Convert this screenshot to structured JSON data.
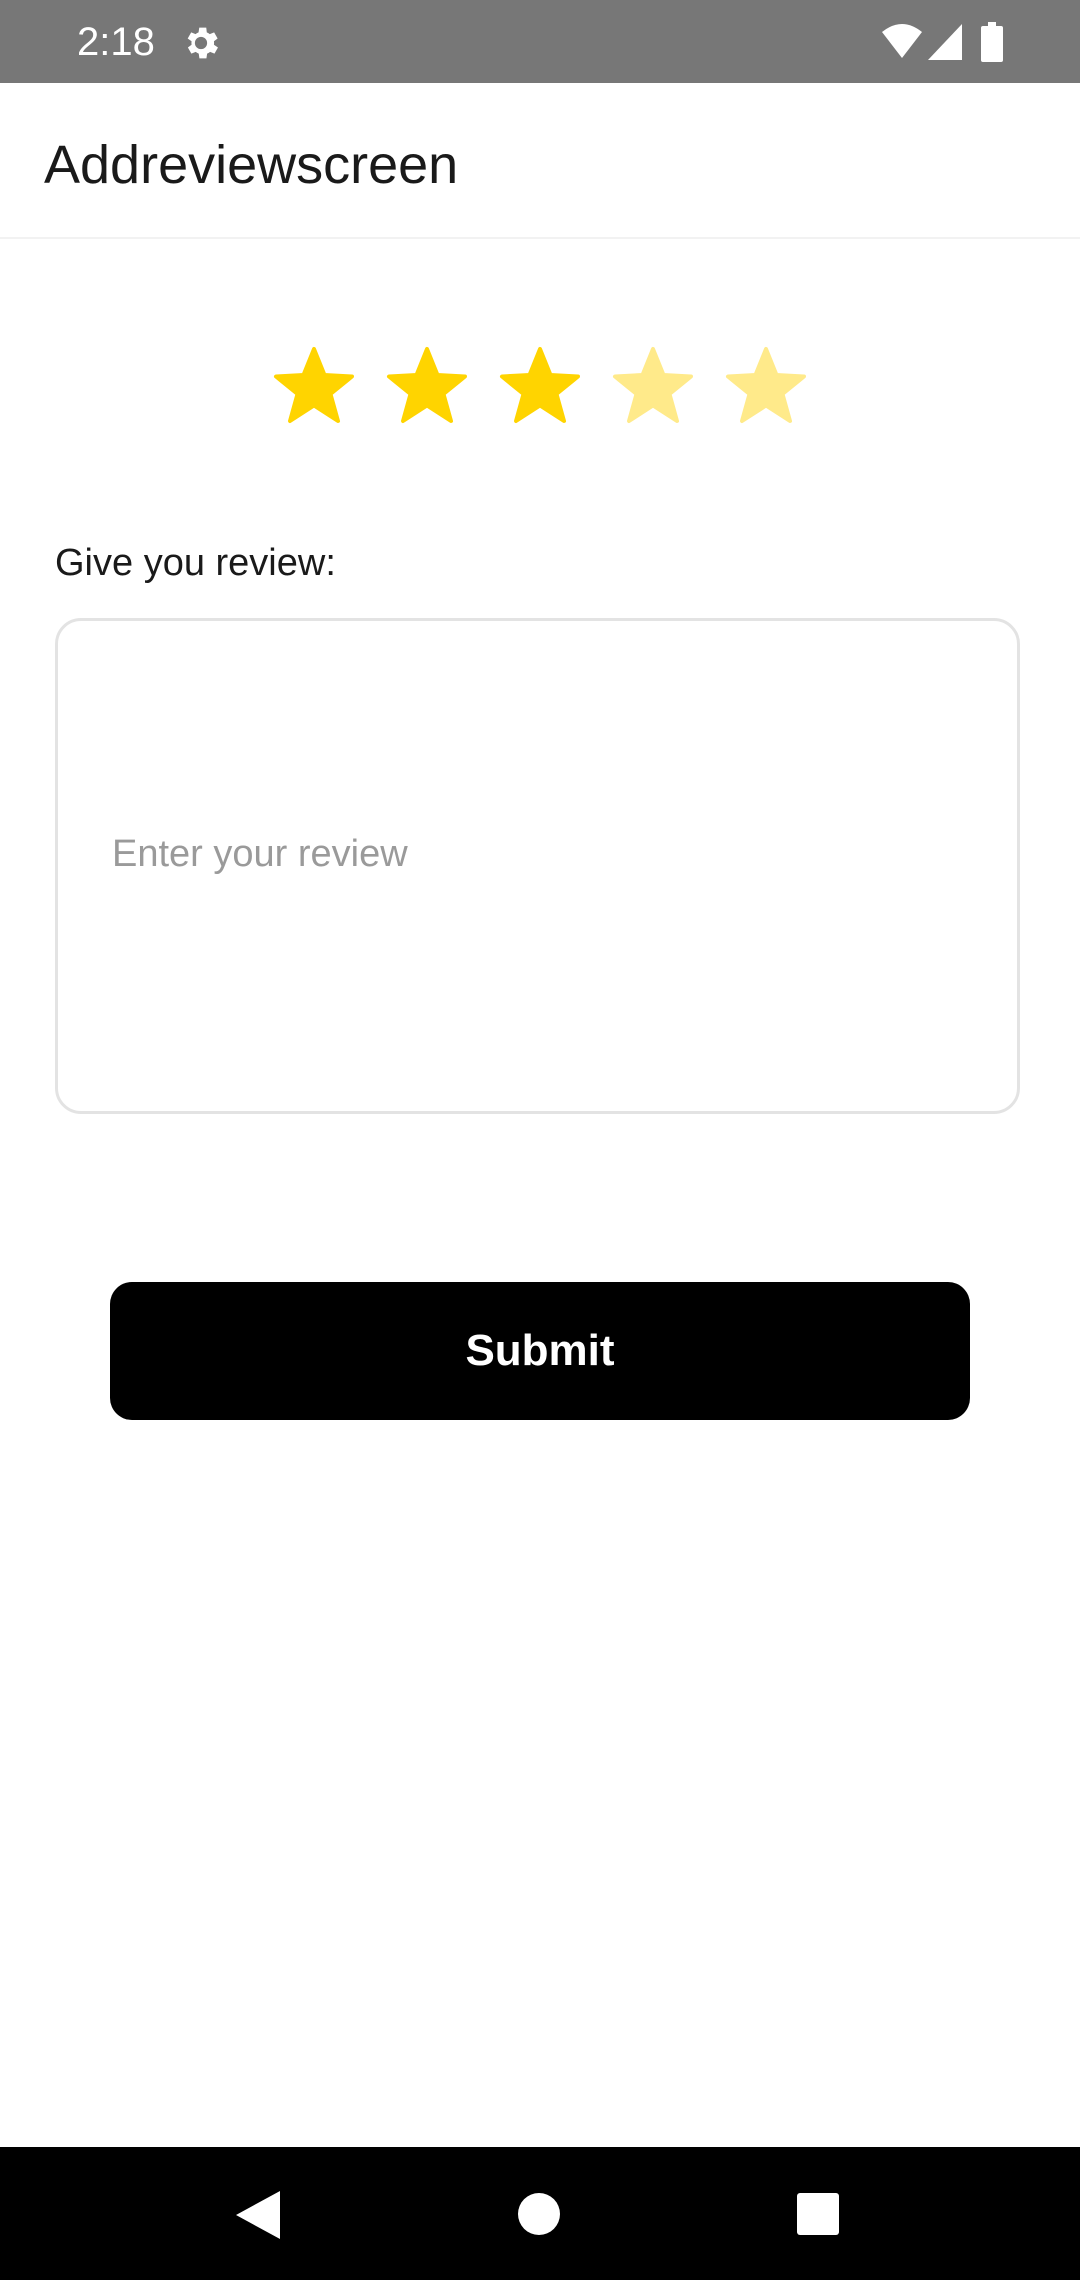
{
  "status_bar": {
    "time": "2:18",
    "icons": [
      "gear-icon",
      "wifi-icon",
      "signal-icon",
      "battery-icon"
    ]
  },
  "app_bar": {
    "title": "Addreviewscreen"
  },
  "rating": {
    "value": 3,
    "max": 5,
    "filled_color": "#FFD400",
    "empty_color": "#FFEA8A"
  },
  "review": {
    "label": "Give you review:",
    "placeholder": "Enter your review",
    "value": ""
  },
  "submit": {
    "label": "Submit"
  },
  "nav_bar": {
    "icons": [
      "back-icon",
      "home-icon",
      "recents-icon"
    ]
  }
}
